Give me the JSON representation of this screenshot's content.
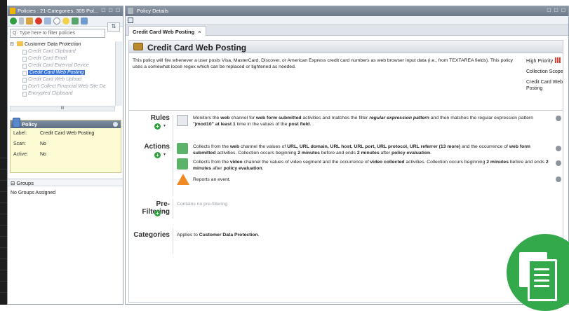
{
  "left_panel": {
    "title": "Policies : 21-Categories, 305 Pol...",
    "window_controls": "☐ ☐ ☐",
    "filter_placeholder": "Type here to filter policies",
    "tree": {
      "root": "Customer Data Protection",
      "children": [
        {
          "label": "Credit Card Clipboard",
          "selected": false
        },
        {
          "label": "Credit Card Email",
          "selected": false
        },
        {
          "label": "Credit Card External Device",
          "selected": false
        },
        {
          "label": "Credit Card Web Posting",
          "selected": true
        },
        {
          "label": "Credit Card Web Upload",
          "selected": false
        },
        {
          "label": "Don't Collect Financial Web Site Da",
          "selected": false
        },
        {
          "label": "Encrypted Clipboard",
          "selected": false
        }
      ]
    },
    "scroll_grip": "III",
    "policy_card": {
      "title": "Policy",
      "rows": [
        {
          "key": "Label:",
          "value": "Credit Card Web Posting"
        },
        {
          "key": "Scan:",
          "value": "No"
        },
        {
          "key": "Active:",
          "value": "No"
        }
      ]
    },
    "groups": {
      "title": "Groups",
      "body": "No Groups Assigned"
    }
  },
  "right_panel": {
    "title": "Policy Details",
    "window_controls": "☐ ☐ ☐",
    "tab_label": "Credit Card Web Posting",
    "tab_close": "×",
    "heading": "Credit Card Web Posting",
    "description": "This policy will fire whenever a user posts Visa, MasterCard, Discover, or American Express credit card numbers as web browser input data (i.e., from TEXTAREA fields). This policy uses a somewhat loose regex which can be replaced or tightened as needed.",
    "priority": "High Priority",
    "collection_scope_label": "Collection Scope",
    "collection_scope_value": "Credit Card Web Posting",
    "sections": {
      "rules": "Rules",
      "actions": "Actions",
      "prefiltering": "Pre-Filtering",
      "categories": "Categories"
    },
    "rules_text": {
      "a": "Monitors the ",
      "b": "web",
      "c": " channel for ",
      "d": "web form submitted",
      "e": " activities and matches the filter ",
      "f": "regular expression pattern",
      "g": " and then matches the regular expression pattern \"",
      "h": ")mod10\" at least 1",
      "i": " time in the values of the ",
      "j": "post field",
      "k": "."
    },
    "action1_text": {
      "a": "Collects from the ",
      "b": "web",
      "c": " channel the values of ",
      "d": "URL, URL domain, URL host, URL port, URL protocol, URL referrer (13 more)",
      "e": " and the occurrence of ",
      "f": "web form submitted",
      "g": " activities. Collection occurs beginning ",
      "h": "2 minutes",
      "i": " before and ends ",
      "j": "2 minutes",
      "k": " after ",
      "l": "policy evaluation",
      "m": "."
    },
    "action2_text": {
      "a": "Collects from the ",
      "b": "video",
      "c": " channel the values of video segment and the occurrence of ",
      "d": "video collected",
      "e": " activities. Collection occurs beginning ",
      "f": "2 minutes",
      "g": " before and ends ",
      "h": "2 minutes",
      "i": " after ",
      "j": "policy evaluation",
      "k": "."
    },
    "action3_text": "Reports an event.",
    "prefiltering_text": "Contains no pre-filtering",
    "categories_text": {
      "a": "Applies to ",
      "b": "Customer Data Protection",
      "c": "."
    }
  },
  "colors": {
    "selection": "#3b74d7",
    "add_green": "#2e9e3e",
    "priority_red": "#e53b2a",
    "brand_green": "#33a94b"
  }
}
